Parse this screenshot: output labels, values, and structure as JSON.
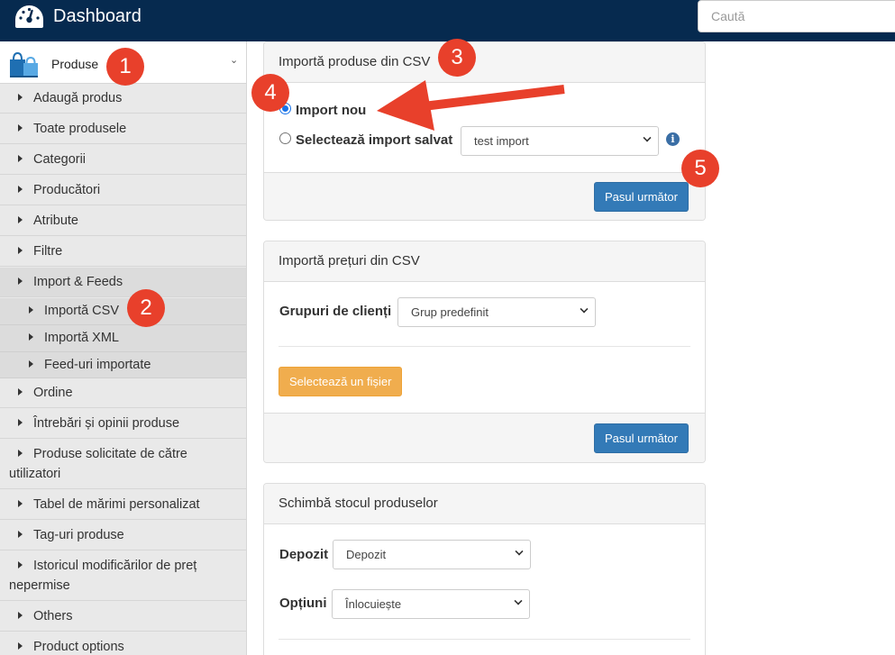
{
  "header": {
    "title": "Dashboard",
    "search_placeholder": "Caută"
  },
  "sidebar": {
    "section_label": "Produse",
    "items": [
      {
        "label": "Adaugă produs"
      },
      {
        "label": "Toate produsele"
      },
      {
        "label": "Categorii"
      },
      {
        "label": "Producători"
      },
      {
        "label": "Atribute"
      },
      {
        "label": "Filtre"
      },
      {
        "label": "Import & Feeds"
      },
      {
        "label": "Importă CSV"
      },
      {
        "label": "Importă XML"
      },
      {
        "label": "Feed-uri importate"
      },
      {
        "label": "Ordine"
      },
      {
        "label": "Întrebări și opinii produse"
      },
      {
        "label": "Produse solicitate de către utilizatori"
      },
      {
        "label": "Tabel de mărimi personalizat"
      },
      {
        "label": "Tag-uri produse"
      },
      {
        "label": "Istoricul modificărilor de preț nepermise"
      },
      {
        "label": "Others"
      },
      {
        "label": "Product options"
      }
    ]
  },
  "import_products": {
    "heading": "Importă produse din CSV",
    "radio_new": "Import nou",
    "radio_saved": "Selectează import salvat",
    "saved_select_value": "test import",
    "info_glyph": "i",
    "next_button": "Pasul următor"
  },
  "import_prices": {
    "heading": "Importă prețuri din CSV",
    "groups_label": "Grupuri de clienți",
    "groups_value": "Grup predefinit",
    "select_file_button": "Selectează un fișier",
    "next_button": "Pasul următor"
  },
  "change_stock": {
    "heading": "Schimbă stocul produselor",
    "warehouse_label": "Depozit",
    "warehouse_value": "Depozit",
    "options_label": "Opțiuni",
    "options_value": "Înlocuiește"
  },
  "annotations": {
    "badge_1": "1",
    "badge_2": "2",
    "badge_3": "3",
    "badge_4": "4",
    "badge_5": "5",
    "color": "#e8402b"
  },
  "colors": {
    "topbar": "#062a4f",
    "primary": "#337ab7",
    "warning": "#f0ad4e"
  }
}
